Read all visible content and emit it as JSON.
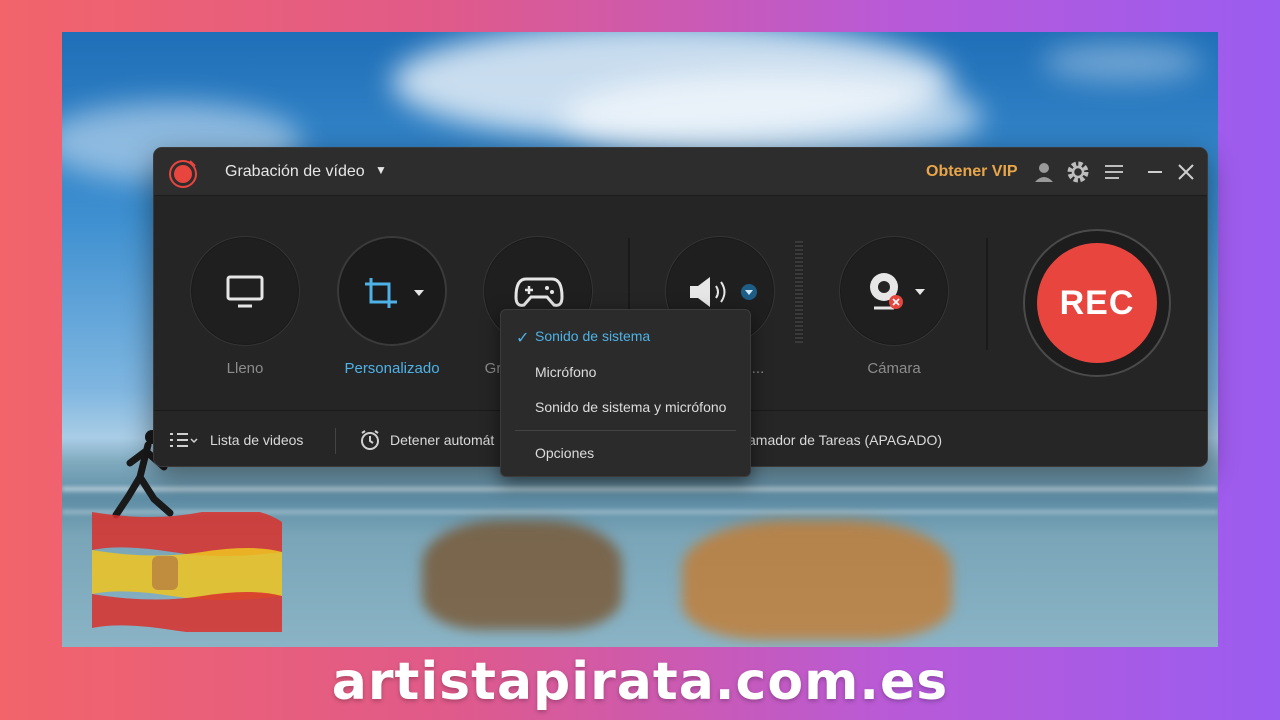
{
  "window": {
    "title": "Grabación de vídeo",
    "vip_label": "Obtener VIP"
  },
  "modes": [
    {
      "label": "Lleno",
      "icon": "monitor-icon",
      "active": false
    },
    {
      "label": "Personalizado",
      "icon": "crop-icon",
      "active": true
    },
    {
      "label": "Gr",
      "icon": "gamepad-icon",
      "active": false
    },
    {
      "label": "...",
      "icon": "speaker-icon",
      "active": false
    },
    {
      "label": "Cámara",
      "icon": "webcam-icon",
      "active": false
    }
  ],
  "rec_button": {
    "label": "REC"
  },
  "bottombar": {
    "video_list": "Lista de videos",
    "auto_stop": "Detener automát",
    "scheduler": "amador de Tareas (APAGADO)"
  },
  "audio_menu": {
    "items": [
      {
        "label": "Sonido de sistema",
        "checked": true
      },
      {
        "label": "Micrófono",
        "checked": false
      },
      {
        "label": "Sonido de sistema y micrófono",
        "checked": false
      },
      {
        "label": "Opciones",
        "checked": false
      }
    ]
  },
  "watermark": "artistapirata.com.es",
  "colors": {
    "accent": "#4fb2e6",
    "vip": "#e8a64a",
    "rec": "#e8453e",
    "window_bg": "#252525"
  }
}
